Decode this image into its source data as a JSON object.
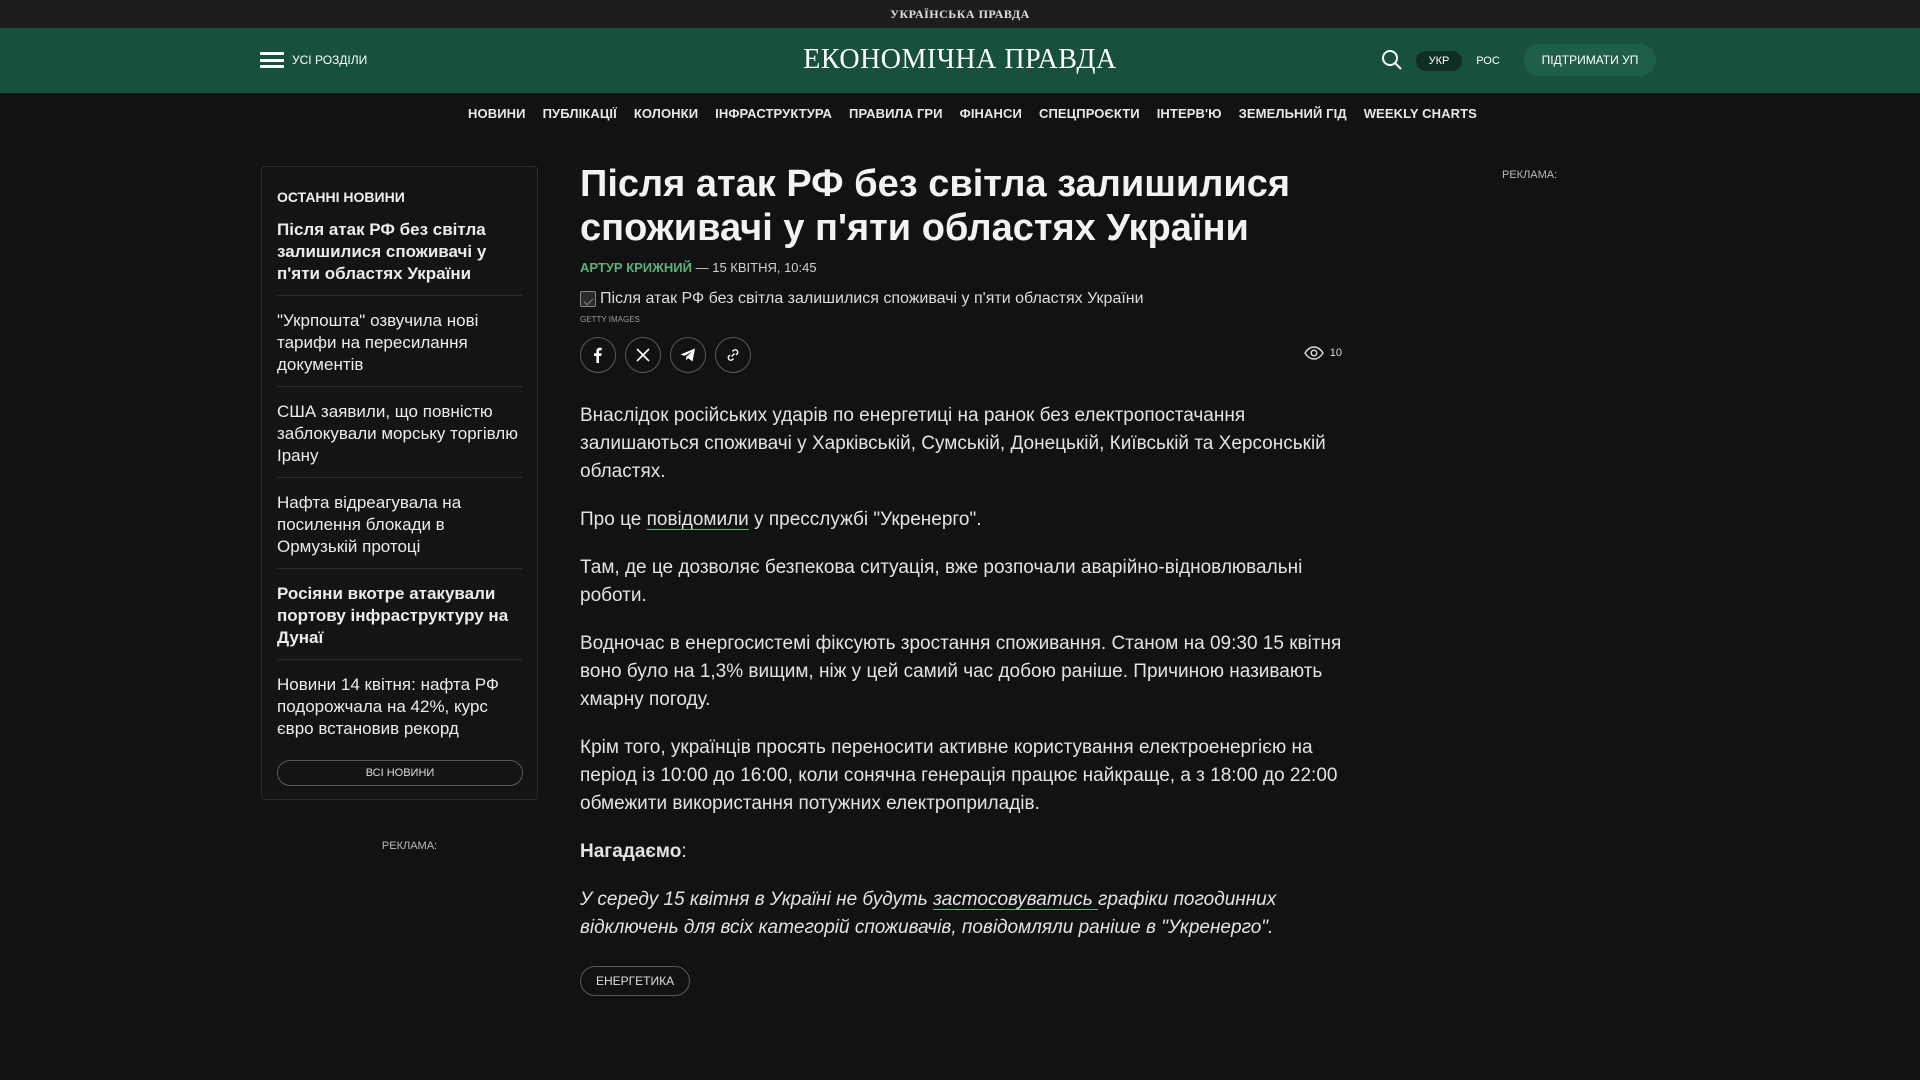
{
  "topstrip": {
    "title": "УКРАЇНСЬКА ПРАВДА"
  },
  "header": {
    "menu_label": "УСІ РОЗДІЛИ",
    "logo": "ЕКОНОМІЧНА ПРАВДА",
    "lang_active": "УКР",
    "lang_other": "РОС",
    "support_label": "ПІДТРИМАТИ УП"
  },
  "nav": {
    "items": [
      "НОВИНИ",
      "ПУБЛІКАЦІЇ",
      "КОЛОНКИ",
      "ІНФРАСТРУКТУРА",
      "ПРАВИЛА ГРИ",
      "ФІНАНСИ",
      "СПЕЦПРОЄКТИ",
      "ІНТЕРВ'Ю",
      "ЗЕМЕЛЬНИЙ ГІД",
      "WEEKLY CHARTS"
    ]
  },
  "sidebar": {
    "title": "ОСТАННІ НОВИНИ",
    "items": [
      {
        "text": "Після атак РФ без світла залишилися споживачі у п'яти областях України"
      },
      {
        "text": "\"Укрпошта\" озвучила нові тарифи на пересилання документів"
      },
      {
        "text": "США заявили, що повністю заблокували морську торгівлю Ірану"
      },
      {
        "text": "Нафта відреагувала на посилення блокади в Ормузькій протоці"
      },
      {
        "text": "Росіяни вкотре атакували портову інфраструктуру на Дунаї"
      },
      {
        "text": "Новини 14 квітня: нафта РФ подорожчала на 42%, курс євро встановив рекорд"
      }
    ],
    "all_news_label": "ВСІ НОВИНИ"
  },
  "ads": {
    "label_right": "РЕКЛАМА:",
    "label_left": "РЕКЛАМА:"
  },
  "article": {
    "title": "Після атак РФ без світла залишилися споживачі у п'яти областях України",
    "author": "Артур Крижний",
    "date": " — 15 КВІТНЯ, 10:45",
    "image_alt": "Після атак РФ без світла залишилися споживачі у п'яти областях України",
    "image_credit": "GETTY IMAGES",
    "views": "10",
    "paragraphs": {
      "p1": "Внаслідок російських ударів по енергетиці на ранок без електропостачання залишаються споживачі у Харківській, Сумській, Донецькій, Київській та Херсонській областях.",
      "p2_before": "Про це ",
      "p2_link": "повідомили",
      "p2_after": " у пресслужбі \"Укренерго\".",
      "p3": "Там, де це дозволяє безпекова ситуація, вже розпочали аварійно-відновлювальні роботи.",
      "p4": "Водночас в енергосистемі фіксують зростання споживання. Станом на 09:30 15 квітня воно було на 1,3% вищим, ніж у цей самий час добою раніше. Причиною називають хмарну погоду.",
      "p5": "Крім того, українців просять переносити активне користування електроенергією на період із 10:00 до 16:00, коли сонячна генерація працює найкраще, а з 18:00 до 22:00 обмежити використання потужних електроприладів.",
      "p6_bold": "Нагадаємо",
      "p6_colon": ":",
      "p7_before": "У середу 15 квітня в Україні не будуть ",
      "p7_link": "застосовуватись ",
      "p7_after": "графіки погодинних відключень для всіх категорій споживачів, повідомляли раніше в \"Укренерго\"."
    },
    "tag": "ЕНЕРГЕТИКА"
  },
  "icons": {
    "menu": "hamburger-icon",
    "search": "search-icon",
    "facebook": "facebook-icon",
    "x": "x-icon",
    "telegram": "telegram-icon",
    "link": "link-icon",
    "views": "eye-icon"
  }
}
